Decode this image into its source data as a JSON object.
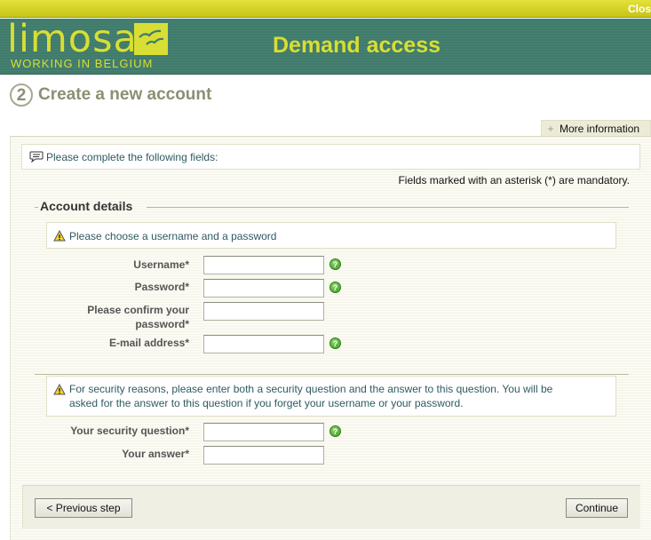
{
  "window": {
    "close_label": "Close"
  },
  "header": {
    "logo_text": "limosa",
    "logo_tagline": "WORKING IN BELGIUM",
    "title": "Demand access",
    "colors": {
      "bar": "#d8d62a",
      "band": "#3f7b6b",
      "accent": "#d8de34"
    }
  },
  "step": {
    "number": "2",
    "title": "Create a new account"
  },
  "more_info": {
    "label": "More information",
    "icon": "plus-icon"
  },
  "notice": {
    "icon": "speech-bubble-icon",
    "text": "Please complete the following fields:"
  },
  "mandatory_note": "Fields marked with an asterisk (*) are mandatory.",
  "account": {
    "legend": "Account details",
    "warning": "Please choose a username and a password",
    "fields": {
      "username": {
        "label": "Username*",
        "value": ""
      },
      "password": {
        "label": "Password*",
        "value": ""
      },
      "confirm_line1": "Please confirm your",
      "confirm_line2": "password*",
      "confirm_value": "",
      "email": {
        "label": "E-mail address*",
        "value": ""
      }
    }
  },
  "security": {
    "warning_line1": "For security reasons, please enter both a security question and the answer to this question. You will be",
    "warning_line2": "asked for the answer to this question if you forget your username or your password.",
    "question": {
      "label": "Your security question*",
      "value": ""
    },
    "answer": {
      "label": "Your answer*",
      "value": ""
    }
  },
  "buttons": {
    "previous": "< Previous step",
    "continue": "Continue"
  },
  "help_icon_glyph": "?"
}
